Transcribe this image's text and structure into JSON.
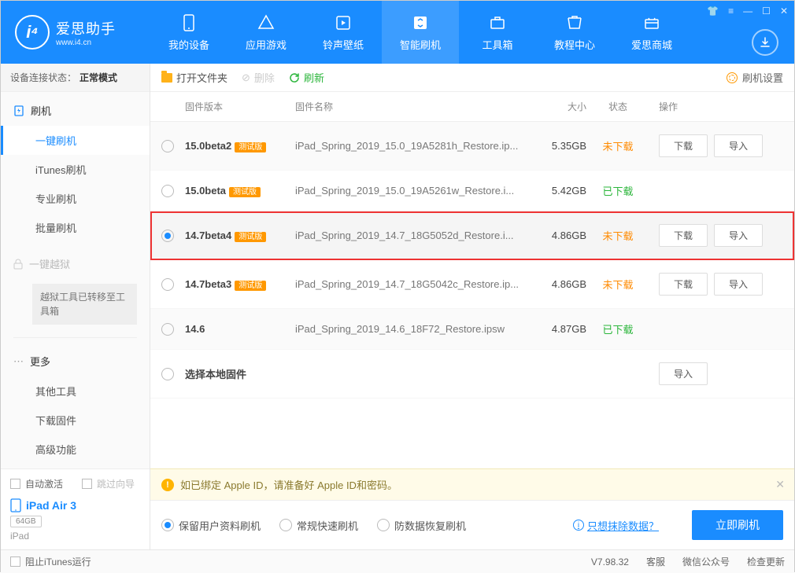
{
  "logo": {
    "title": "爱思助手",
    "subtitle": "www.i4.cn",
    "glyph": "i⁴"
  },
  "nav": [
    {
      "label": "我的设备"
    },
    {
      "label": "应用游戏"
    },
    {
      "label": "铃声壁纸"
    },
    {
      "label": "智能刷机",
      "active": true
    },
    {
      "label": "工具箱"
    },
    {
      "label": "教程中心"
    },
    {
      "label": "爱思商城"
    }
  ],
  "statusbar": {
    "label": "设备连接状态：",
    "value": "正常模式"
  },
  "sidebar": {
    "flash": {
      "head": "刷机",
      "items": [
        "一键刷机",
        "iTunes刷机",
        "专业刷机",
        "批量刷机"
      ],
      "active": 0
    },
    "jailbreak": {
      "head": "一键越狱",
      "note": "越狱工具已转移至工具箱"
    },
    "more": {
      "head": "更多",
      "items": [
        "其他工具",
        "下载固件",
        "高级功能"
      ]
    }
  },
  "bottom": {
    "auto_activate": "自动激活",
    "skip_guide": "跳过向导",
    "device_name": "iPad Air 3",
    "storage": "64GB",
    "device_type": "iPad"
  },
  "toolbar": {
    "open": "打开文件夹",
    "delete": "删除",
    "refresh": "刷新",
    "settings": "刷机设置"
  },
  "columns": {
    "version": "固件版本",
    "name": "固件名称",
    "size": "大小",
    "status": "状态",
    "ops": "操作"
  },
  "rows": [
    {
      "version": "15.0beta2",
      "beta": "测试版",
      "name": "iPad_Spring_2019_15.0_19A5281h_Restore.ip...",
      "size": "5.35GB",
      "status": "未下载",
      "st": "no",
      "dl": true,
      "imp": true,
      "sel": false
    },
    {
      "version": "15.0beta",
      "beta": "测试版",
      "name": "iPad_Spring_2019_15.0_19A5261w_Restore.i...",
      "size": "5.42GB",
      "status": "已下载",
      "st": "ok",
      "dl": false,
      "imp": false,
      "sel": false
    },
    {
      "version": "14.7beta4",
      "beta": "测试版",
      "name": "iPad_Spring_2019_14.7_18G5052d_Restore.i...",
      "size": "4.86GB",
      "status": "未下载",
      "st": "no",
      "dl": true,
      "imp": true,
      "sel": true,
      "hl": true
    },
    {
      "version": "14.7beta3",
      "beta": "测试版",
      "name": "iPad_Spring_2019_14.7_18G5042c_Restore.ip...",
      "size": "4.86GB",
      "status": "未下载",
      "st": "no",
      "dl": true,
      "imp": true,
      "sel": false
    },
    {
      "version": "14.6",
      "beta": "",
      "name": "iPad_Spring_2019_14.6_18F72_Restore.ipsw",
      "size": "4.87GB",
      "status": "已下载",
      "st": "ok",
      "dl": false,
      "imp": false,
      "sel": false
    },
    {
      "version": "选择本地固件",
      "beta": "",
      "name": "",
      "size": "",
      "status": "",
      "st": "",
      "dl": false,
      "imp": true,
      "sel": false,
      "local": true
    }
  ],
  "buttons": {
    "download": "下载",
    "import": "导入"
  },
  "notice": "如已绑定 Apple ID，请准备好 Apple ID和密码。",
  "options": {
    "keep": "保留用户资料刷机",
    "fast": "常规快速刷机",
    "antidata": "防数据恢复刷机",
    "eraselink": "只想抹除数据？",
    "flash": "立即刷机"
  },
  "footer": {
    "block_itunes": "阻止iTunes运行",
    "version": "V7.98.32",
    "service": "客服",
    "wechat": "微信公众号",
    "update": "检查更新"
  }
}
